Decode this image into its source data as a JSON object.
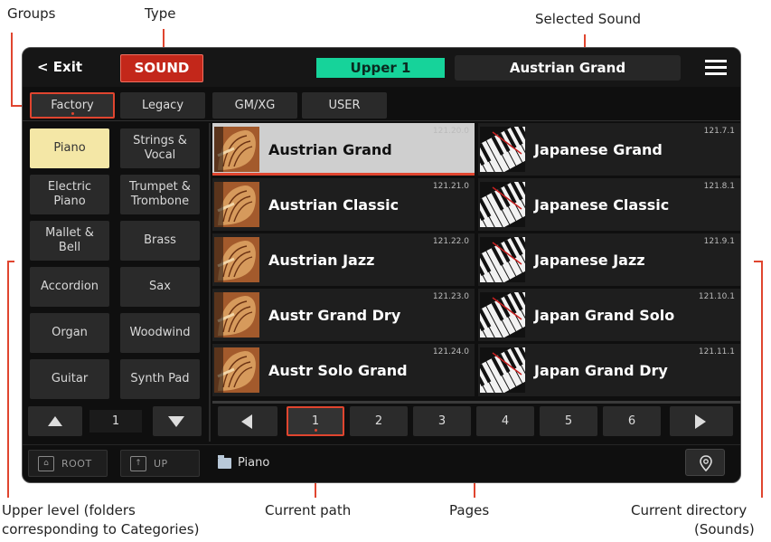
{
  "callouts": {
    "groups": "Groups",
    "type": "Type",
    "selected_sound": "Selected Sound",
    "upper_level_1": "Upper level (folders",
    "upper_level_2": "corresponding to Categories)",
    "current_path": "Current path",
    "pages": "Pages",
    "current_directory_1": "Current directory",
    "current_directory_2": "(Sounds)"
  },
  "topbar": {
    "exit": "< Exit",
    "type": "SOUND",
    "keyboard_part": "Upper 1",
    "selected_sound": "Austrian Grand",
    "menu_icon": "hamburger-menu-icon"
  },
  "groups": [
    "Factory",
    "Legacy",
    "GM/XG",
    "USER"
  ],
  "categories": [
    [
      "Piano",
      "Strings &\nVocal"
    ],
    [
      "Electric\nPiano",
      "Trumpet &\nTrombone"
    ],
    [
      "Mallet &\nBell",
      "Brass"
    ],
    [
      "Accordion",
      "Sax"
    ],
    [
      "Organ",
      "Woodwind"
    ],
    [
      "Guitar",
      "Synth Pad"
    ]
  ],
  "sounds": [
    {
      "name": "Austrian Grand",
      "num": "121.20.0",
      "icon": "grand-piano-icon"
    },
    {
      "name": "Japanese Grand",
      "num": "121.7.1",
      "icon": "piano-keys-icon"
    },
    {
      "name": "Austrian Classic",
      "num": "121.21.0",
      "icon": "grand-piano-icon"
    },
    {
      "name": "Japanese Classic",
      "num": "121.8.1",
      "icon": "piano-keys-icon"
    },
    {
      "name": "Austrian Jazz",
      "num": "121.22.0",
      "icon": "grand-piano-icon"
    },
    {
      "name": "Japanese Jazz",
      "num": "121.9.1",
      "icon": "piano-keys-icon"
    },
    {
      "name": "Austr Grand Dry",
      "num": "121.23.0",
      "icon": "grand-piano-icon"
    },
    {
      "name": "Japan Grand Solo",
      "num": "121.10.1",
      "icon": "piano-keys-icon"
    },
    {
      "name": "Austr Solo Grand",
      "num": "121.24.0",
      "icon": "grand-piano-icon"
    },
    {
      "name": "Japan Grand Dry",
      "num": "121.11.1",
      "icon": "piano-keys-icon"
    }
  ],
  "category_page": "1",
  "pages": [
    "1",
    "2",
    "3",
    "4",
    "5",
    "6"
  ],
  "folders": {
    "root": "ROOT",
    "up": "UP"
  },
  "path": "Piano",
  "colors": {
    "accent": "#e0452f",
    "type_red": "#c3271a",
    "upper_green": "#16d39a",
    "selected_cat": "#f4e7a6"
  }
}
